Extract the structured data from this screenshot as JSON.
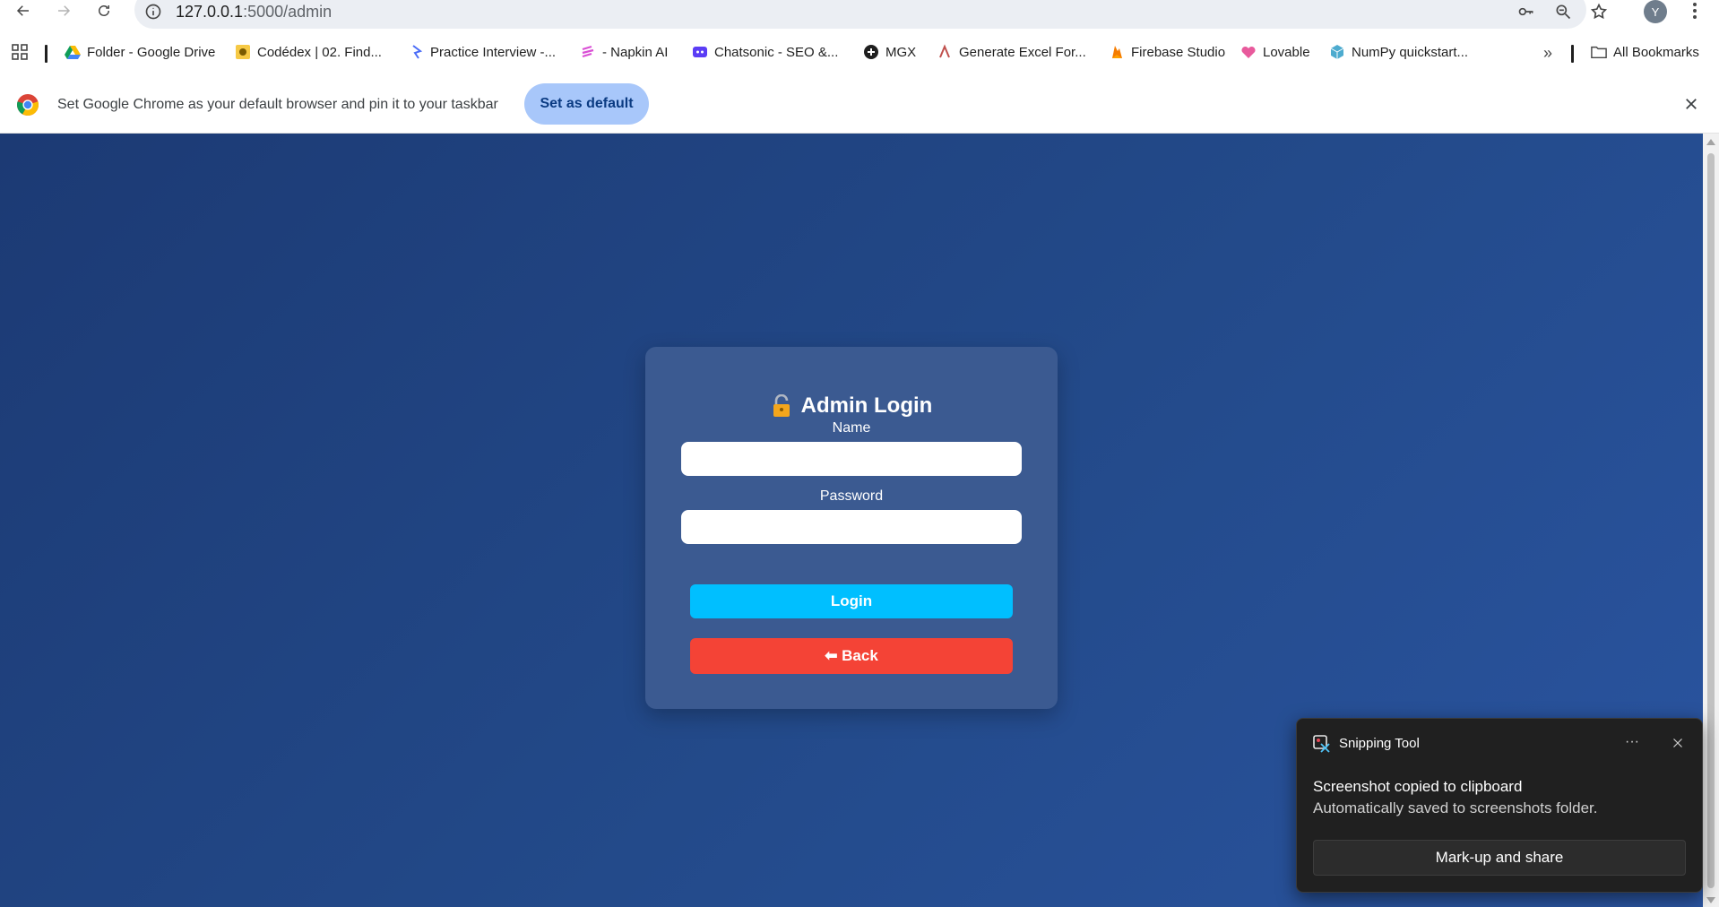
{
  "browser": {
    "url_host": "127.0.0.1",
    "url_path": ":5000/admin",
    "profile_initial": "Y",
    "bookmarks": [
      {
        "label": "Folder - Google Drive",
        "icon": "google-drive-icon"
      },
      {
        "label": "Codédex | 02. Find...",
        "icon": "codedex-icon"
      },
      {
        "label": "Practice Interview -...",
        "icon": "practice-interview-icon"
      },
      {
        "label": "- Napkin AI",
        "icon": "napkin-ai-icon"
      },
      {
        "label": "Chatsonic - SEO &...",
        "icon": "chatsonic-icon"
      },
      {
        "label": "MGX",
        "icon": "mgx-icon"
      },
      {
        "label": "Generate Excel For...",
        "icon": "excel-formula-icon"
      },
      {
        "label": "Firebase Studio",
        "icon": "firebase-icon"
      },
      {
        "label": "Lovable",
        "icon": "lovable-icon"
      },
      {
        "label": "NumPy quickstart...",
        "icon": "numpy-icon"
      }
    ],
    "all_bookmarks_label": "All Bookmarks",
    "infobar": {
      "message": "Set Google Chrome as your default browser and pin it to your taskbar",
      "button_label": "Set as default"
    }
  },
  "login": {
    "title": "Admin Login",
    "title_icon": "lock-icon",
    "name_label": "Name",
    "name_value": "",
    "password_label": "Password",
    "password_value": "",
    "login_button": "Login",
    "back_button": "⬅ Back"
  },
  "toast": {
    "app_name": "Snipping Tool",
    "heading": "Screenshot copied to clipboard",
    "body": "Automatically saved to screenshots folder.",
    "action_label": "Mark-up and share",
    "more_label": "···"
  },
  "colors": {
    "page_bg": "#234a8a",
    "card_bg": "#3b5a91",
    "login_btn": "#00bfff",
    "back_btn": "#f44336",
    "infobar_btn": "#a8c7fa"
  }
}
